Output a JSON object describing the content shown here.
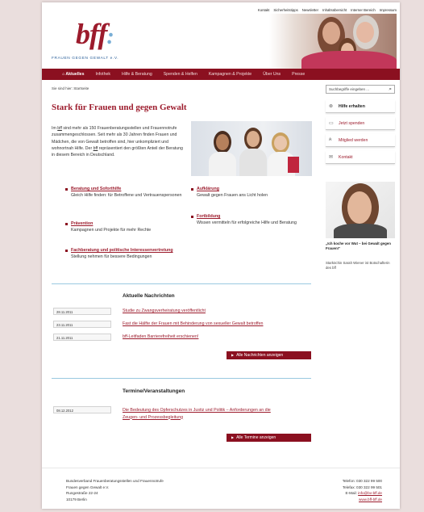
{
  "topnav": [
    "Kontakt",
    "Sicherheitstipps",
    "Newsletter",
    "Inhaltsübersicht",
    "Interner Bereich",
    "Impressum"
  ],
  "logo": {
    "text": "bff",
    "tagline": "FRAUEN GEGEN GEWALT e.V."
  },
  "mainnav": [
    {
      "label": "Aktuelles",
      "active": true
    },
    {
      "label": "Infothek"
    },
    {
      "label": "Hilfe & Beratung"
    },
    {
      "label": "Spenden & Helfen"
    },
    {
      "label": "Kampagnen & Projekte"
    },
    {
      "label": "Über Uns"
    },
    {
      "label": "Presse"
    }
  ],
  "breadcrumb": "Sie sind hier: Startseite",
  "search": {
    "placeholder": "Suchbegriffe eingeben ..."
  },
  "heading": "Stark für Frauen und gegen Gewalt",
  "intro": {
    "p1": "Im ",
    "bff": "bff",
    "p2": " sind mehr als 150 Frauenberatungsstellen und Frauennotrufe zusammengeschlossen. Seit mehr als 30 Jahren finden Frauen und Mädchen, die von Gewalt betroffen sind, hier unkompliziert und wohnortnah Hilfe. Der ",
    "bff2": "bff",
    "p3": " repräsentiert den größten Anteil der Beratung in diesem Bereich in Deutschland."
  },
  "services": [
    {
      "title": "Beratung und Soforthilfe",
      "desc": "Gleich Hilfe finden: für Betroffene und Vertrauenspersonen"
    },
    {
      "title": "Aufklärung",
      "desc": "Gewalt gegen Frauen ans Licht holen"
    },
    {
      "title": "Prävention",
      "desc": "Kampagnen und Projekte für mehr Rechte"
    },
    {
      "title": "Fortbildung",
      "desc": "Wissen vermitteln für erfolgreiche Hilfe und Beratung"
    },
    {
      "title": "Fachberatung und politische Interessenvertretung",
      "desc": "Stellung nehmen für bessere Bedingungen"
    }
  ],
  "news": {
    "title": "Aktuelle Nachrichten",
    "items": [
      {
        "date": "28.11.2011",
        "text": "Studie zu Zwangsverheiratung veröffentlicht"
      },
      {
        "date": "23.11.2011",
        "text": "Fast die Hälfte der Frauen mit Behinderung von sexueller Gewalt betroffen"
      },
      {
        "date": "21.11.2011",
        "text": "bff-Leitfaden Barrierefreiheit erschienen!"
      }
    ],
    "button": "Alle Nachrichten anzeigen"
  },
  "events": {
    "title": "Termine/Veranstaltungen",
    "items": [
      {
        "date": "08.12.2012",
        "line1": "Die Bedeutung des Opferschutzes in Justiz und Politik – Anforderungen an die",
        "line2": "Zeugen- und Prozessbegleitung"
      }
    ],
    "button": "Alle Termine anzeigen"
  },
  "sidebar": {
    "items": [
      {
        "label": "Hilfe erhalten",
        "icon": "lifebuoy-icon",
        "glyph": "⊗"
      },
      {
        "label": "Jetzt spenden",
        "icon": "card-icon",
        "glyph": "▭"
      },
      {
        "label": "Mitglied werden",
        "icon": "people-icon",
        "glyph": "ጰ"
      },
      {
        "label": "Kontakt",
        "icon": "mail-icon",
        "glyph": "✉"
      }
    ],
    "quote": "„Ich koche vor Wut – bei Gewalt gegen Frauen!“",
    "caption": "Starköchin Sarah Wiener ist Botschafterin des bff"
  },
  "footer": {
    "address": [
      "Bundesverband Frauenberatungsstellen und Frauennotrufe",
      "Frauen gegen Gewalt e.V.",
      "Rungestraße 22-24",
      "10179 Berlin"
    ],
    "phone": "Telefon: 030 322 99 500",
    "fax": "Telefax: 030 322 99 501",
    "email_label": "E-Mail: ",
    "email": "info@bv-bff.de",
    "web": "www.bff-bff.de"
  },
  "colors": {
    "brand": "#9c1b2c",
    "nav": "#8b1020",
    "divider": "#9ac9e0"
  }
}
